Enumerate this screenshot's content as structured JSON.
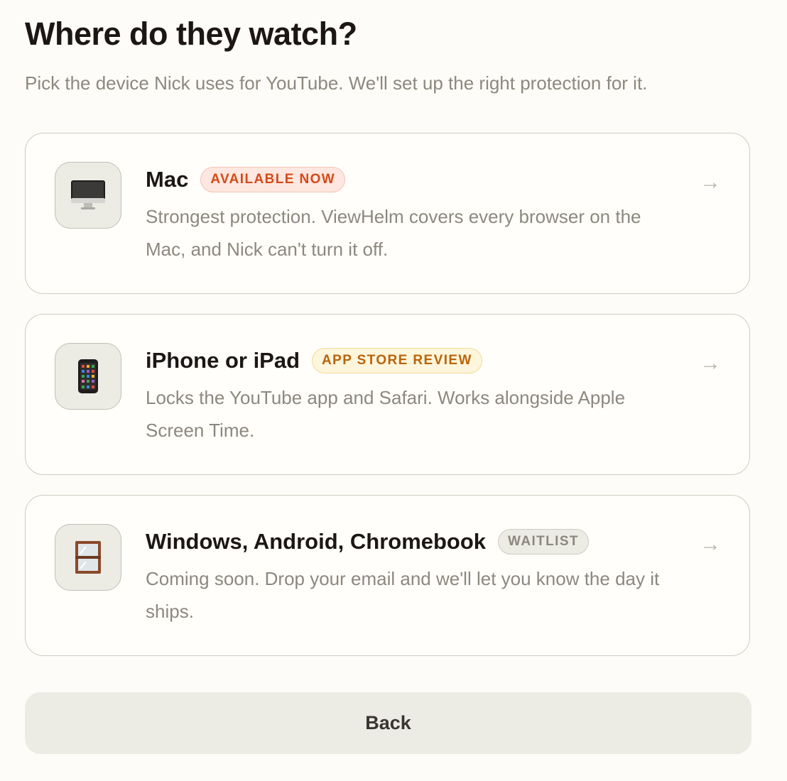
{
  "header": {
    "title": "Where do they watch?",
    "subtitle": "Pick the device Nick uses for YouTube. We'll set up the right protection for it."
  },
  "devices": [
    {
      "title": "Mac",
      "badge": "AVAILABLE NOW",
      "badge_style": "available",
      "description": "Strongest protection. ViewHelm covers every browser on the Mac, and Nick can't turn it off.",
      "icon": "desktop-computer-icon",
      "arrow": "→"
    },
    {
      "title": "iPhone or iPad",
      "badge": "APP STORE REVIEW",
      "badge_style": "review",
      "description": "Locks the YouTube app and Safari. Works alongside Apple Screen Time.",
      "icon": "mobile-phone-icon",
      "arrow": "→"
    },
    {
      "title": "Windows, Android, Chromebook",
      "badge": "WAITLIST",
      "badge_style": "waitlist",
      "description": "Coming soon. Drop your email and we'll let you know the day it ships.",
      "icon": "window-icon",
      "arrow": "→"
    }
  ],
  "colors": {
    "available_text": "#d64a18",
    "review_text": "#b8640a",
    "waitlist_text": "#8d887f"
  },
  "footer": {
    "back_label": "Back"
  }
}
